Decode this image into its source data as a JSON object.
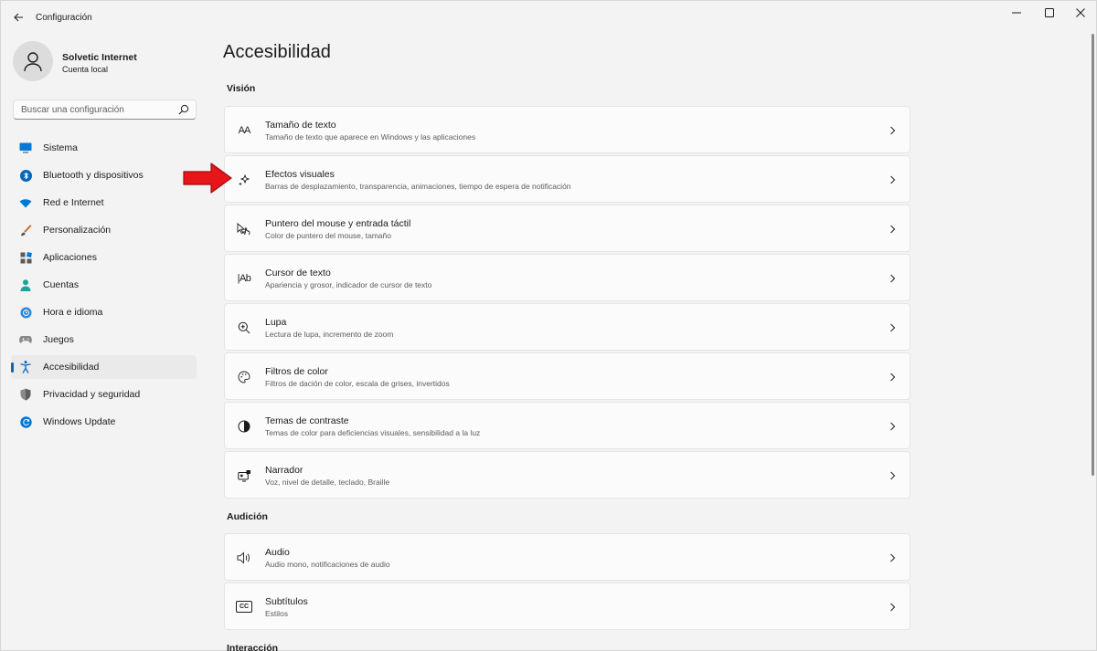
{
  "window": {
    "title": "Configuración"
  },
  "user": {
    "name": "Solvetic Internet",
    "account_type": "Cuenta local"
  },
  "search": {
    "placeholder": "Buscar una configuración"
  },
  "nav": {
    "items": [
      {
        "label": "Sistema",
        "icon": "system-icon"
      },
      {
        "label": "Bluetooth y dispositivos",
        "icon": "bluetooth-icon"
      },
      {
        "label": "Red e Internet",
        "icon": "wifi-icon"
      },
      {
        "label": "Personalización",
        "icon": "brush-icon"
      },
      {
        "label": "Aplicaciones",
        "icon": "apps-icon"
      },
      {
        "label": "Cuentas",
        "icon": "person-icon"
      },
      {
        "label": "Hora e idioma",
        "icon": "globe-icon"
      },
      {
        "label": "Juegos",
        "icon": "gamepad-icon"
      },
      {
        "label": "Accesibilidad",
        "icon": "accessibility-icon",
        "active": true
      },
      {
        "label": "Privacidad y seguridad",
        "icon": "shield-icon"
      },
      {
        "label": "Windows Update",
        "icon": "update-icon"
      }
    ]
  },
  "main": {
    "title": "Accesibilidad",
    "sections": [
      {
        "title": "Visión",
        "cards": [
          {
            "title": "Tamaño de texto",
            "subtitle": "Tamaño de texto que aparece en Windows y las aplicaciones",
            "icon": "text-size-icon",
            "icon_text": "AA"
          },
          {
            "title": "Efectos visuales",
            "subtitle": "Barras de desplazamiento, transparencia, animaciones, tiempo de espera de notificación",
            "icon": "sparkle-icon"
          },
          {
            "title": "Puntero del mouse y entrada táctil",
            "subtitle": "Color de puntero del mouse, tamaño",
            "icon": "pointer-icon"
          },
          {
            "title": "Cursor de texto",
            "subtitle": "Apariencia y grosor, indicador de cursor de texto",
            "icon": "text-cursor-icon",
            "icon_text": "|Ab"
          },
          {
            "title": "Lupa",
            "subtitle": "Lectura de lupa, incremento de zoom",
            "icon": "magnifier-icon"
          },
          {
            "title": "Filtros de color",
            "subtitle": "Filtros de dación de color, escala de grises, invertidos",
            "icon": "palette-icon"
          },
          {
            "title": "Temas de contraste",
            "subtitle": "Temas de color para deficiencias visuales, sensibilidad a la luz",
            "icon": "contrast-icon"
          },
          {
            "title": "Narrador",
            "subtitle": "Voz, nivel de detalle, teclado, Braille",
            "icon": "narrator-icon"
          }
        ]
      },
      {
        "title": "Audición",
        "cards": [
          {
            "title": "Audio",
            "subtitle": "Audio mono, notificaciones de audio",
            "icon": "speaker-icon"
          },
          {
            "title": "Subtítulos",
            "subtitle": "Estilos",
            "icon": "captions-icon",
            "icon_text": "CC"
          }
        ]
      },
      {
        "title": "Interacción",
        "cards": []
      }
    ]
  },
  "colors": {
    "accent": "#0067c0",
    "background": "#f3f3f3",
    "card": "#fbfbfb",
    "annotation_arrow": "#e8161b"
  }
}
